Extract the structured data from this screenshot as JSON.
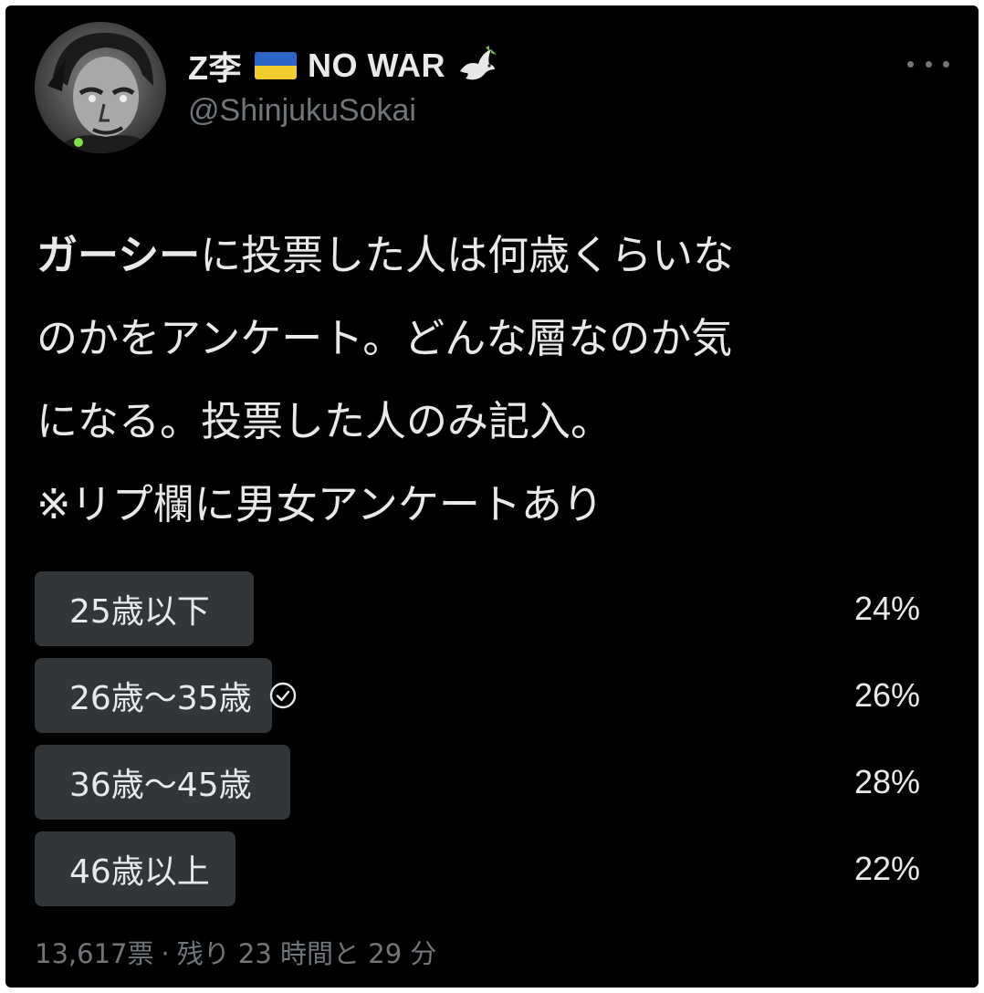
{
  "author": {
    "display_name_text": "Z李",
    "flag_icon": "ukraine-flag-icon",
    "display_name_suffix": "NO WAR",
    "dove_icon": "dove-icon",
    "handle": "@ShinjukuSokai"
  },
  "menu": {
    "icon": "more-options-icon"
  },
  "tweet": {
    "line1_bold": "ガーシー",
    "line1_rest": "に投票した人は何歳くらいな",
    "line2": "のかをアンケート。どんな層なのか気",
    "line3": "になる。投票した人のみ記入。",
    "line4": "※リプ欄に男女アンケートあり"
  },
  "poll": {
    "options": [
      {
        "label": "25歳以下",
        "percent_text": "24%",
        "percent": 24,
        "selected": false
      },
      {
        "label": "26歳〜35歳",
        "percent_text": "26%",
        "percent": 26,
        "selected": true
      },
      {
        "label": "36歳〜45歳",
        "percent_text": "28%",
        "percent": 28,
        "selected": false
      },
      {
        "label": "46歳以上",
        "percent_text": "22%",
        "percent": 22,
        "selected": false
      }
    ],
    "votes": "13,617票",
    "separator": "·",
    "time_left": "残り 23 時間と 29 分",
    "bar_color": "#333639",
    "text_color": "#e7e9ea",
    "muted_color": "#71767b"
  }
}
